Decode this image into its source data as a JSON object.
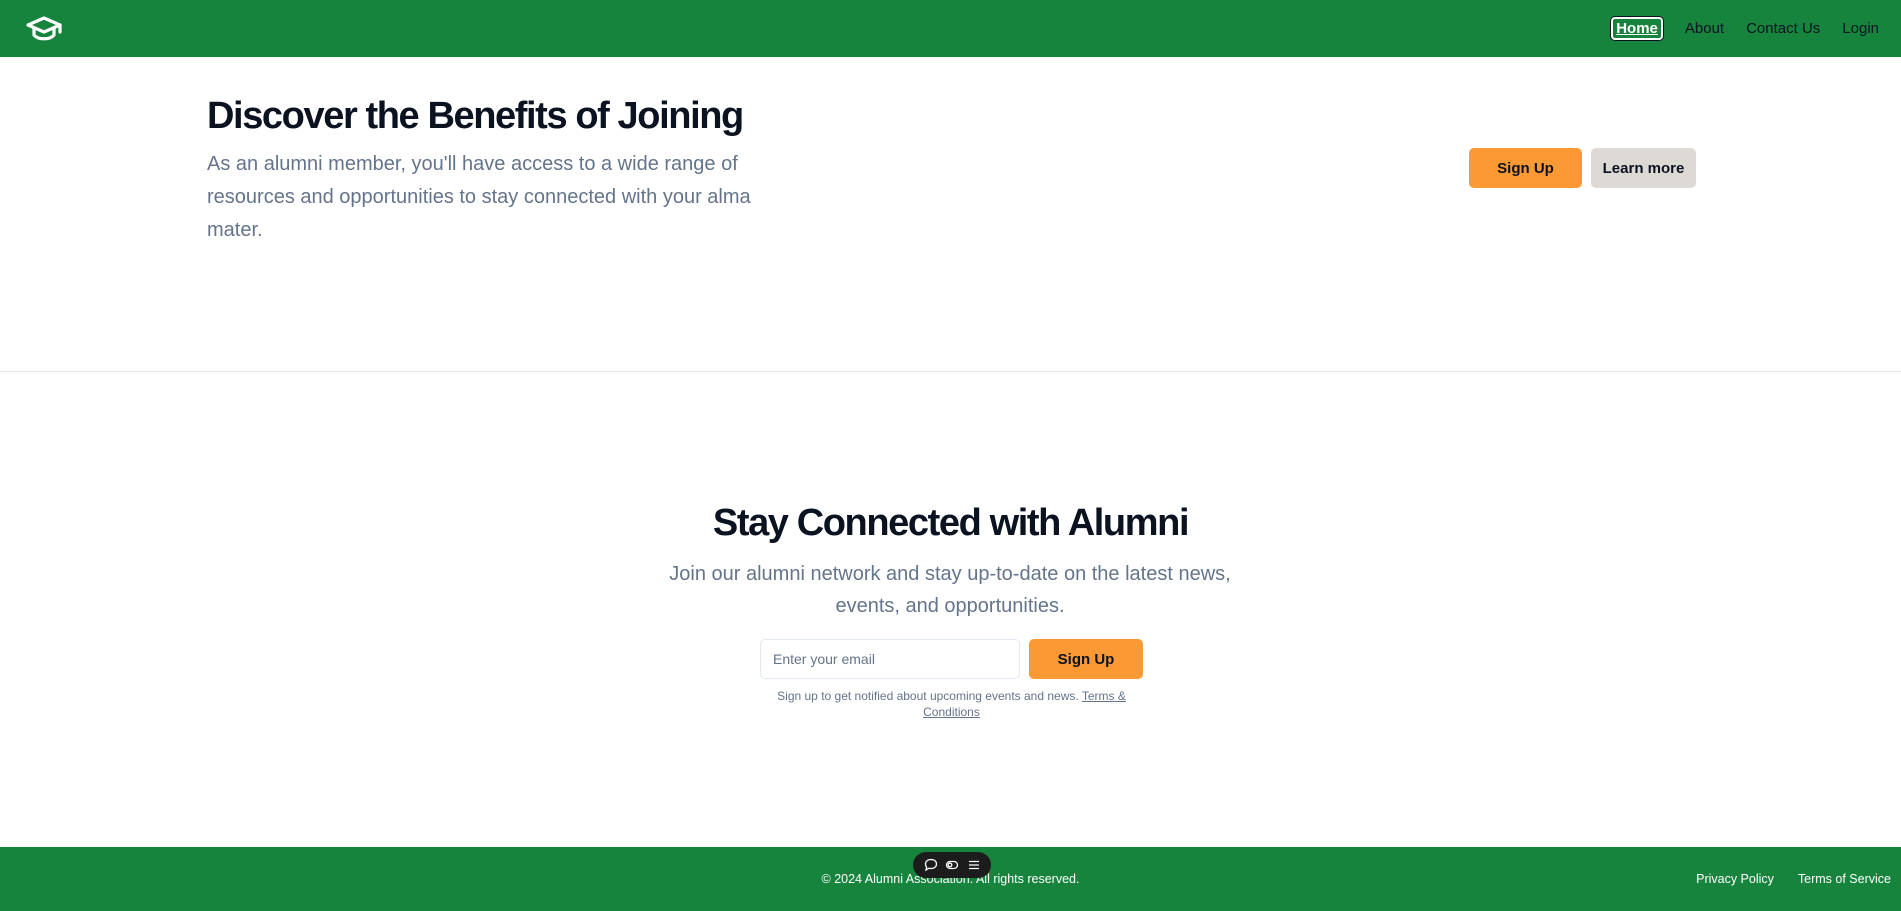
{
  "header": {
    "logo_icon": "graduation-cap-icon",
    "nav": [
      {
        "label": "Home",
        "active": true
      },
      {
        "label": "About"
      },
      {
        "label": "Contact Us"
      },
      {
        "label": "Login"
      }
    ]
  },
  "hero": {
    "title": "Discover the Benefits of Joining",
    "subtitle": "As an alumni member, you'll have access to a wide range of resources and opportunities to stay connected with your alma mater.",
    "signup_label": "Sign Up",
    "learn_label": "Learn more"
  },
  "connect": {
    "title": "Stay Connected with Alumni",
    "subtitle": "Join our alumni network and stay up-to-date on the latest news, events, and opportunities.",
    "email_placeholder": "Enter your email",
    "signup_label": "Sign Up",
    "fine_print": "Sign up to get notified about upcoming events and news.",
    "terms_link": "Terms & Conditions"
  },
  "footer": {
    "copyright": "© 2024 Alumni Association. All rights reserved.",
    "links": [
      "Privacy Policy",
      "Terms of Service"
    ]
  },
  "toolbar": {
    "icons": [
      "chat-icon",
      "eye-toggle-icon",
      "menu-icon"
    ]
  },
  "colors": {
    "brand_green": "#17843e",
    "accent_orange": "#fb9a35",
    "secondary_gray": "#ddd9d5",
    "muted_text": "#64748b"
  }
}
